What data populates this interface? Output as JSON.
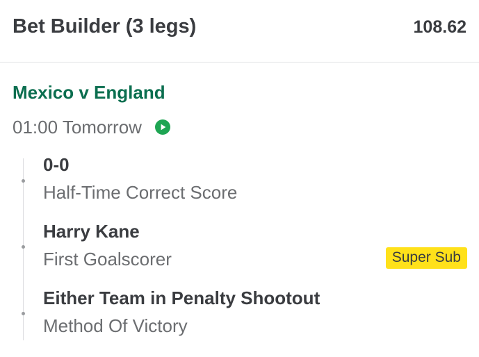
{
  "header": {
    "title": "Bet Builder (3 legs)",
    "odds": "108.62"
  },
  "event": {
    "name": "Mexico v England",
    "time": "01:00 Tomorrow",
    "status_icon": "play-circle-icon",
    "accent_color": "#0b6e4f",
    "icon_color": "#1ea553"
  },
  "legs": [
    {
      "selection": "0-0",
      "market": "Half-Time Correct Score"
    },
    {
      "selection": "Harry Kane",
      "market": "First Goalscorer",
      "badge": "Super Sub"
    },
    {
      "selection": "Either Team in Penalty Shootout",
      "market": "Method Of Victory"
    }
  ],
  "colors": {
    "badge_bg": "#ffe11a",
    "text_primary": "#3a3c40",
    "text_secondary": "#6b6d70"
  }
}
